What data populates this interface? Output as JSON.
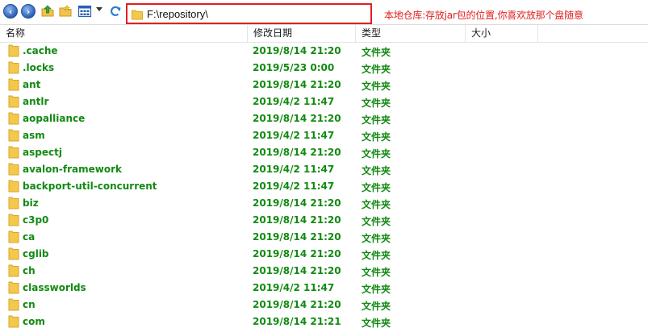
{
  "toolbar": {
    "address": "F:\\repository\\",
    "annotation": "本地仓库:存放jar包的位置,你喜欢放那个盘随意"
  },
  "columns": {
    "name": "名称",
    "date": "修改日期",
    "type": "类型",
    "size": "大小"
  },
  "colors": {
    "row_text": "#128a12",
    "annotation": "#e02020",
    "folder": "#f4c84a"
  },
  "rows": [
    {
      "name": ".cache",
      "date": "2019/8/14 21:20",
      "type": "文件夹"
    },
    {
      "name": ".locks",
      "date": "2019/5/23 0:00",
      "type": "文件夹"
    },
    {
      "name": "ant",
      "date": "2019/8/14 21:20",
      "type": "文件夹"
    },
    {
      "name": "antlr",
      "date": "2019/4/2 11:47",
      "type": "文件夹"
    },
    {
      "name": "aopalliance",
      "date": "2019/8/14 21:20",
      "type": "文件夹"
    },
    {
      "name": "asm",
      "date": "2019/4/2 11:47",
      "type": "文件夹"
    },
    {
      "name": "aspectj",
      "date": "2019/8/14 21:20",
      "type": "文件夹"
    },
    {
      "name": "avalon-framework",
      "date": "2019/4/2 11:47",
      "type": "文件夹"
    },
    {
      "name": "backport-util-concurrent",
      "date": "2019/4/2 11:47",
      "type": "文件夹"
    },
    {
      "name": "biz",
      "date": "2019/8/14 21:20",
      "type": "文件夹"
    },
    {
      "name": "c3p0",
      "date": "2019/8/14 21:20",
      "type": "文件夹"
    },
    {
      "name": "ca",
      "date": "2019/8/14 21:20",
      "type": "文件夹"
    },
    {
      "name": "cglib",
      "date": "2019/8/14 21:20",
      "type": "文件夹"
    },
    {
      "name": "ch",
      "date": "2019/8/14 21:20",
      "type": "文件夹"
    },
    {
      "name": "classworlds",
      "date": "2019/4/2 11:47",
      "type": "文件夹"
    },
    {
      "name": "cn",
      "date": "2019/8/14 21:20",
      "type": "文件夹"
    },
    {
      "name": "com",
      "date": "2019/8/14 21:21",
      "type": "文件夹"
    }
  ]
}
